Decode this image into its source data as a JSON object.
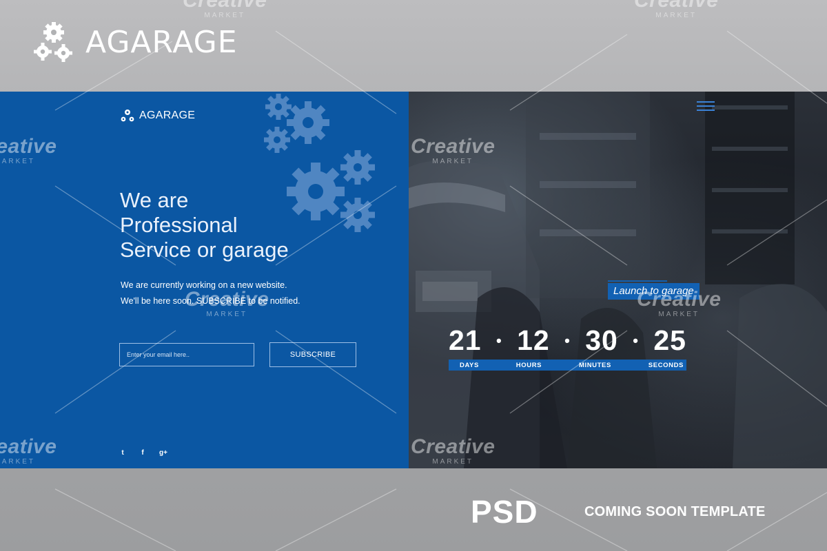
{
  "banner": {
    "brand": "AGARAGE",
    "badge": "PSD",
    "template_type": "COMING SOON TEMPLATE"
  },
  "left_panel": {
    "brand": "AGARAGE",
    "headline": [
      "We are",
      "Professional",
      "Service or garage"
    ],
    "subtext": [
      "We are currently working on a new website.",
      "We'll be here soon. SUBSCRIBE to be notified."
    ],
    "email_placeholder": "Enter your email here..",
    "subscribe_label": "SUBSCRIBE",
    "social": [
      {
        "icon": "twitter-icon",
        "glyph": "t"
      },
      {
        "icon": "facebook-icon",
        "glyph": "f"
      },
      {
        "icon": "google-plus-icon",
        "glyph": "g+"
      }
    ]
  },
  "right_panel": {
    "launch_label": "Launch to garage",
    "countdown": {
      "days": "21",
      "hours": "12",
      "minutes": "30",
      "seconds": "25",
      "separator": "•",
      "labels": {
        "days": "DAYS",
        "hours": "HOURS",
        "minutes": "MINUTES",
        "seconds": "SECONDS"
      }
    }
  },
  "watermark": {
    "line1": "Creative",
    "line2": "MARKET"
  },
  "colors": {
    "primary_blue": "#0b57a3",
    "accent_blue": "#1261b3",
    "banner_gray": "#a9aaac"
  }
}
